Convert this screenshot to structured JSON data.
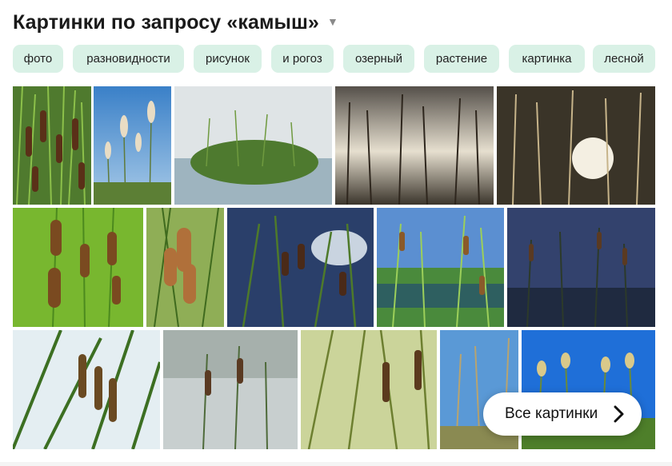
{
  "header": {
    "title": "Картинки по запросу «камыш»",
    "caret_icon": "triangle-down-icon"
  },
  "chips": [
    {
      "label": "фото"
    },
    {
      "label": "разновидности"
    },
    {
      "label": "рисунок"
    },
    {
      "label": "и рогоз"
    },
    {
      "label": "озерный"
    },
    {
      "label": "растение"
    },
    {
      "label": "картинка"
    },
    {
      "label": "лесной"
    }
  ],
  "images": [
    {
      "subject": "cattails-close-green"
    },
    {
      "subject": "pampas-grass-blue-sky"
    },
    {
      "subject": "reed-clump-in-lake"
    },
    {
      "subject": "reeds-sunset-silhouette"
    },
    {
      "subject": "reeds-backlit-sun"
    },
    {
      "subject": "cattails-bright-green"
    },
    {
      "subject": "cattails-macro"
    },
    {
      "subject": "cattails-dark-blue-sky"
    },
    {
      "subject": "cattails-lakeside"
    },
    {
      "subject": "cattails-night-water"
    },
    {
      "subject": "cattails-leaves-closeup"
    },
    {
      "subject": "cattails-misty-forest"
    },
    {
      "subject": "cattails-pale-green"
    },
    {
      "subject": "reeds-blue-sky"
    },
    {
      "subject": "reeds-golden-tops"
    }
  ],
  "more_button": {
    "label": "Все картинки",
    "icon": "chevron-right-icon"
  },
  "colors": {
    "chip_bg": "#d9f1e6",
    "title_text": "#1a1a1a"
  }
}
